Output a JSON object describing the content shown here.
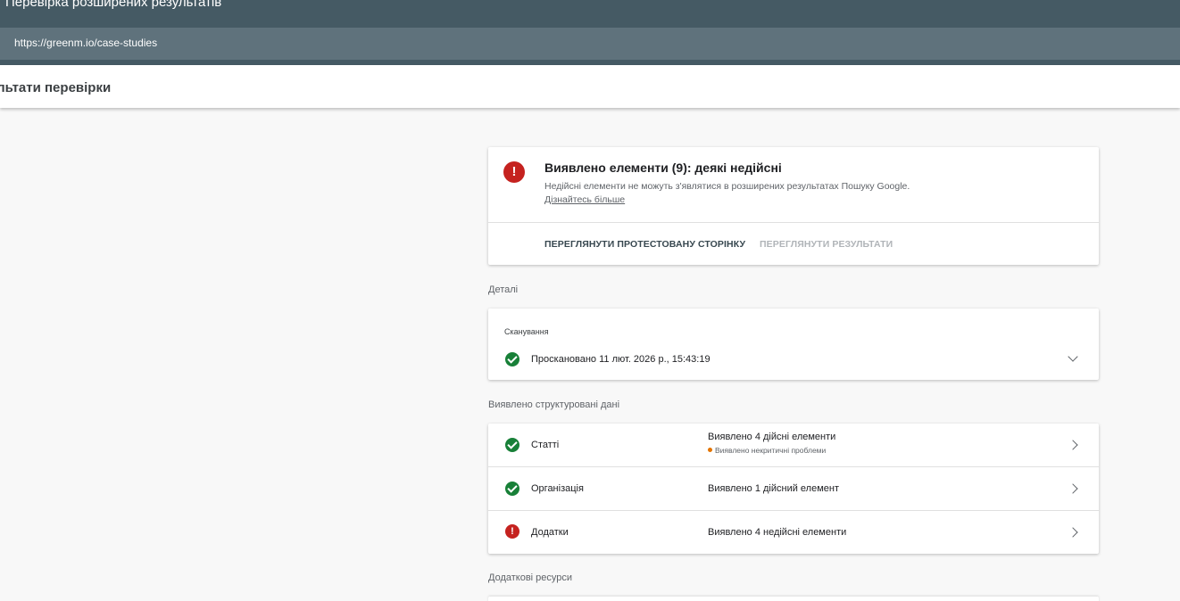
{
  "app": {
    "title": "Перевірка розширених результатів",
    "url": "https://greenm.io/case-studies"
  },
  "subheader": {
    "title": "ультати перевірки"
  },
  "summary": {
    "title": "Виявлено елементи (9): деякі недійсні",
    "description": "Недійсні елементи не можуть з'являтися в розширених результатах Пошуку Google.",
    "learn_more": "Дізнайтесь більше",
    "view_tested_page": "ПЕРЕГЛЯНУТИ ПРОТЕСТОВАНУ СТОРІНКУ",
    "view_results": "ПЕРЕГЛЯНУТИ РЕЗУЛЬТАТИ"
  },
  "details": {
    "label": "Деталі",
    "crawl_label": "Сканування",
    "crawl_status": "Проскановано 11 лют. 2026 р., 15:43:19"
  },
  "structured_data": {
    "label": "Виявлено структуровані дані",
    "rows": [
      {
        "name": "Статті",
        "status": "Виявлено 4 дійсні елементи",
        "substatus": "Виявлено некритичні проблеми",
        "state": "valid"
      },
      {
        "name": "Організація",
        "status": "Виявлено 1 дійсний елемент",
        "state": "valid"
      },
      {
        "name": "Додатки",
        "status": "Виявлено 4 недійсні елементи",
        "state": "error"
      }
    ]
  },
  "resources": {
    "label": "Додаткові ресурси"
  },
  "colors": {
    "header": "#455a64",
    "url_bar": "#5f727c",
    "error": "#c5221f",
    "success": "#188038",
    "warning": "#e37400"
  },
  "icons": {
    "error": "error-circle-icon",
    "check": "check-circle-icon",
    "expand": "chevron-down-icon",
    "open": "chevron-right-icon"
  }
}
